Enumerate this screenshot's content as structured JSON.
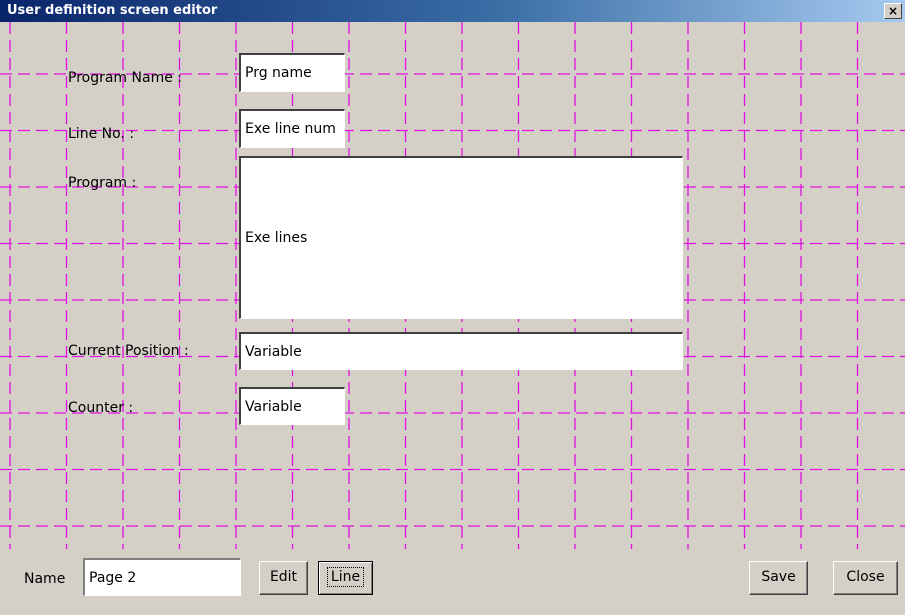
{
  "window": {
    "title": "User definition screen editor",
    "close_glyph": "✕"
  },
  "fields": {
    "program_name": {
      "label": "Program Name :",
      "value": "Prg name"
    },
    "line_no": {
      "label": "Line No. :",
      "value": "Exe line num"
    },
    "program": {
      "label": "Program :",
      "value": "Exe lines"
    },
    "current_position": {
      "label": "Current Position :",
      "value": "Variable"
    },
    "counter": {
      "label": "Counter :",
      "value": "Variable"
    }
  },
  "bottom": {
    "name_label": "Name",
    "name_value": "Page 2",
    "edit_label": "Edit",
    "line_label": "Line",
    "save_label": "Save",
    "close_label": "Close"
  },
  "colors": {
    "grid": "#e010e0",
    "background": "#d4d0c8",
    "titlebar": "#0a246a"
  },
  "icons": {
    "close": "close-icon"
  }
}
